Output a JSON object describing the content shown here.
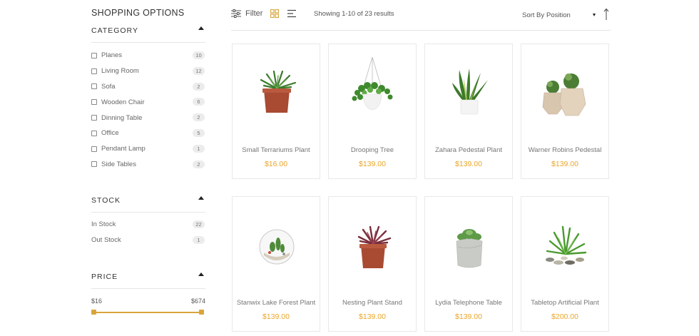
{
  "sidebar": {
    "title": "SHOPPING OPTIONS",
    "category": {
      "label": "CATEGORY",
      "items": [
        {
          "name": "Planes",
          "count": "10"
        },
        {
          "name": "Living Room",
          "count": "12"
        },
        {
          "name": "Sofa",
          "count": "2"
        },
        {
          "name": "Wooden Chair",
          "count": "6"
        },
        {
          "name": "Dinning Table",
          "count": "2"
        },
        {
          "name": "Office",
          "count": "5"
        },
        {
          "name": "Pendant Lamp",
          "count": "1"
        },
        {
          "name": "Side Tables",
          "count": "2"
        }
      ]
    },
    "stock": {
      "label": "STOCK",
      "items": [
        {
          "name": "In Stock",
          "count": "22"
        },
        {
          "name": "Out Stock",
          "count": "1"
        }
      ]
    },
    "price": {
      "label": "PRICE",
      "min": "$16",
      "max": "$674"
    }
  },
  "toolbar": {
    "filter_label": "Filter",
    "results_text": "Showing 1-10 of 23 results",
    "sort_label": "Sort By",
    "sort_value": "Position"
  },
  "products": [
    {
      "name": "Small Terrariums Plant",
      "price": "$16.00"
    },
    {
      "name": "Drooping Tree",
      "price": "$139.00"
    },
    {
      "name": "Zahara Pedestal Plant",
      "price": "$139.00"
    },
    {
      "name": "Warner Robins Pedestal",
      "price": "$139.00"
    },
    {
      "name": "Stanwix Lake Forest Plant",
      "price": "$139.00"
    },
    {
      "name": "Nesting Plant Stand",
      "price": "$139.00"
    },
    {
      "name": "Lydia Telephone Table",
      "price": "$139.00"
    },
    {
      "name": "Tabletop Artificial Plant",
      "price": "$200.00"
    }
  ],
  "colors": {
    "accent": "#d9a53a",
    "price": "#eaa62a",
    "border": "#e8e8e8"
  }
}
